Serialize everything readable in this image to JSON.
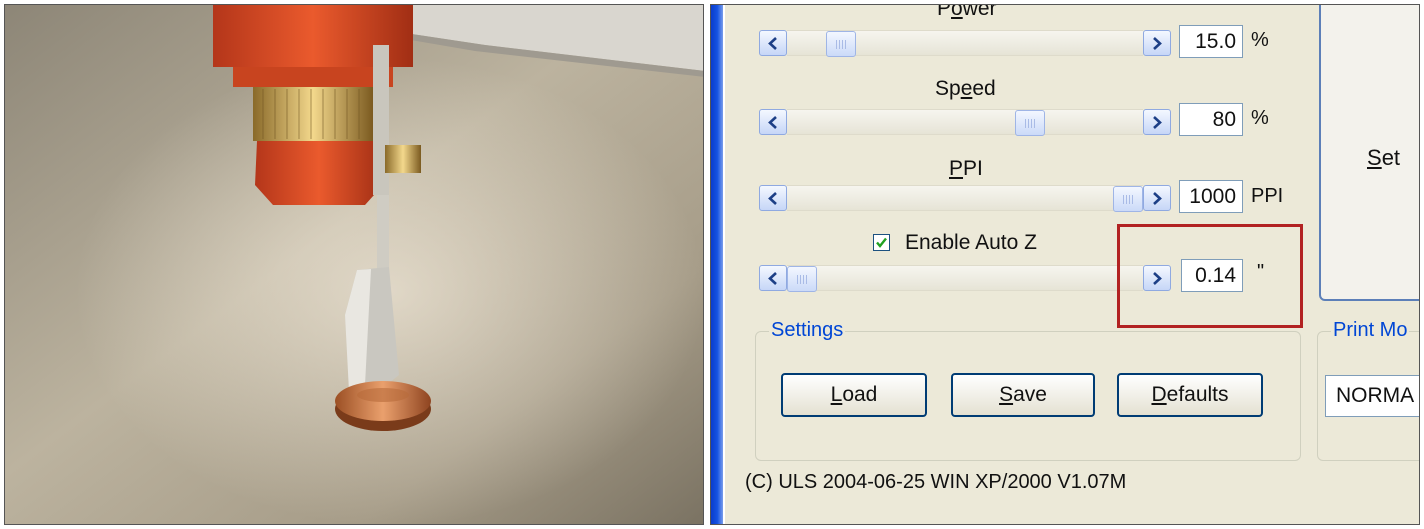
{
  "sliders": [
    {
      "label": "Power",
      "value": "15.0",
      "unit": "%",
      "position": 0.12
    },
    {
      "label": "Speed",
      "value": "80",
      "unit": "%",
      "position": 0.7
    },
    {
      "label": "PPI",
      "value": "1000",
      "unit": "PPI",
      "position": 1.0
    },
    {
      "label": "Enable Auto Z",
      "value": "0.14",
      "unit": "\"",
      "position": 0.0,
      "checked": true
    }
  ],
  "set_button": "Set",
  "settings_group": {
    "title": "Settings",
    "load": "Load",
    "save": "Save",
    "defaults": "Defaults"
  },
  "print_mode_group": {
    "title": "Print Mo",
    "value": "NORMA"
  },
  "footer": "(C) ULS 2004-06-25 WIN XP/2000 V1.07M",
  "colors": {
    "highlight_box": "#b22222",
    "xp_blue": "#0046d5",
    "dialog_bg": "#ece9d8"
  },
  "photo": {
    "subject": "laser-cutter-head-with-auto-z-focus-probe-touching-coin"
  }
}
